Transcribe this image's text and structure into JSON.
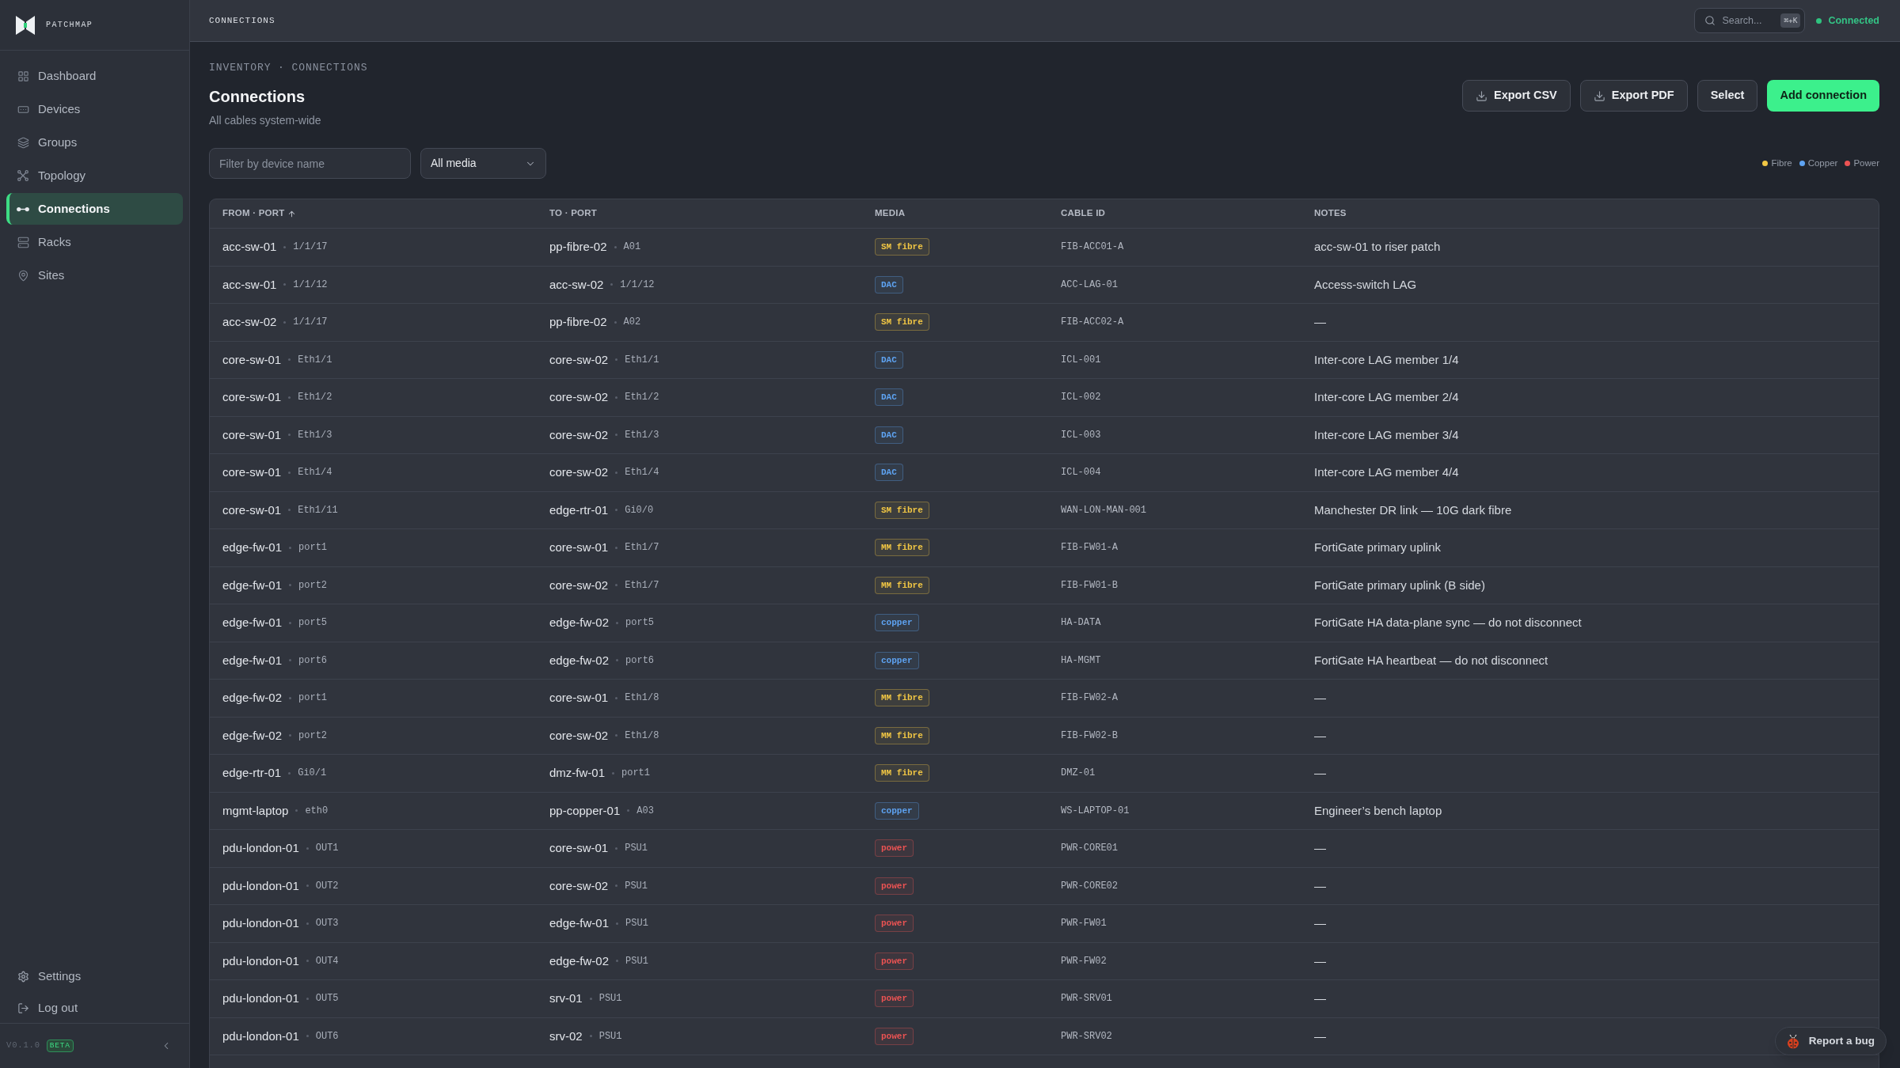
{
  "sidebar": {
    "brand": "PATCHMAP",
    "items": [
      {
        "label": "Dashboard",
        "selected": false
      },
      {
        "label": "Devices",
        "selected": false
      },
      {
        "label": "Groups",
        "selected": false
      },
      {
        "label": "Topology",
        "selected": false
      },
      {
        "label": "Connections",
        "selected": true
      },
      {
        "label": "Racks",
        "selected": false
      },
      {
        "label": "Sites",
        "selected": false
      }
    ],
    "footer_items": [
      {
        "label": "Settings"
      },
      {
        "label": "Log out"
      }
    ],
    "version": "V0.1.0",
    "badge": "BETA"
  },
  "topbar": {
    "title": "CONNECTIONS",
    "search": {
      "placeholder": "Search...",
      "shortcut": "⌘+K"
    },
    "status": "Connected"
  },
  "page": {
    "breadcrumb": "INVENTORY · CONNECTIONS",
    "title": "Connections",
    "subtitle": "All cables system-wide",
    "buttons": [
      {
        "label": "Export CSV",
        "kind": "export"
      },
      {
        "label": "Export PDF",
        "kind": "export"
      },
      {
        "label": "Select",
        "kind": "plain"
      },
      {
        "label": "Add connection",
        "kind": "primary"
      }
    ],
    "filters": {
      "device": {
        "placeholder": "Filter by device name"
      },
      "media": {
        "value": "All media"
      }
    },
    "legend": [
      {
        "label": "Fibre",
        "color": "#f2c744"
      },
      {
        "label": "Copper",
        "color": "#5ea3f2"
      },
      {
        "label": "Power",
        "color": "#ec5353"
      }
    ]
  },
  "table": {
    "columns": [
      {
        "label": "FROM · PORT",
        "sorted": true
      },
      {
        "label": "TO · PORT",
        "sorted": false
      },
      {
        "label": "MEDIA",
        "sorted": false
      },
      {
        "label": "CABLE ID",
        "sorted": false
      },
      {
        "label": "NOTES",
        "sorted": false
      }
    ],
    "rows": [
      {
        "from": {
          "device": "acc-sw-01",
          "port": "1/1/17"
        },
        "to": {
          "device": "pp-fibre-02",
          "port": "A01"
        },
        "media": {
          "label": "SM fibre",
          "color": "#f2c744"
        },
        "cable_id": "FIB-ACC01-A",
        "notes": "acc-sw-01 to riser patch"
      },
      {
        "from": {
          "device": "acc-sw-01",
          "port": "1/1/12"
        },
        "to": {
          "device": "acc-sw-02",
          "port": "1/1/12"
        },
        "media": {
          "label": "DAC",
          "color": "#5ea3f2"
        },
        "cable_id": "ACC-LAG-01",
        "notes": "Access-switch LAG"
      },
      {
        "from": {
          "device": "acc-sw-02",
          "port": "1/1/17"
        },
        "to": {
          "device": "pp-fibre-02",
          "port": "A02"
        },
        "media": {
          "label": "SM fibre",
          "color": "#f2c744"
        },
        "cable_id": "FIB-ACC02-A",
        "notes": "—"
      },
      {
        "from": {
          "device": "core-sw-01",
          "port": "Eth1/1"
        },
        "to": {
          "device": "core-sw-02",
          "port": "Eth1/1"
        },
        "media": {
          "label": "DAC",
          "color": "#5ea3f2"
        },
        "cable_id": "ICL-001",
        "notes": "Inter-core LAG member 1/4"
      },
      {
        "from": {
          "device": "core-sw-01",
          "port": "Eth1/2"
        },
        "to": {
          "device": "core-sw-02",
          "port": "Eth1/2"
        },
        "media": {
          "label": "DAC",
          "color": "#5ea3f2"
        },
        "cable_id": "ICL-002",
        "notes": "Inter-core LAG member 2/4"
      },
      {
        "from": {
          "device": "core-sw-01",
          "port": "Eth1/3"
        },
        "to": {
          "device": "core-sw-02",
          "port": "Eth1/3"
        },
        "media": {
          "label": "DAC",
          "color": "#5ea3f2"
        },
        "cable_id": "ICL-003",
        "notes": "Inter-core LAG member 3/4"
      },
      {
        "from": {
          "device": "core-sw-01",
          "port": "Eth1/4"
        },
        "to": {
          "device": "core-sw-02",
          "port": "Eth1/4"
        },
        "media": {
          "label": "DAC",
          "color": "#5ea3f2"
        },
        "cable_id": "ICL-004",
        "notes": "Inter-core LAG member 4/4"
      },
      {
        "from": {
          "device": "core-sw-01",
          "port": "Eth1/11"
        },
        "to": {
          "device": "edge-rtr-01",
          "port": "Gi0/0"
        },
        "media": {
          "label": "SM fibre",
          "color": "#f2c744"
        },
        "cable_id": "WAN-LON-MAN-001",
        "notes": "Manchester DR link — 10G dark fibre"
      },
      {
        "from": {
          "device": "edge-fw-01",
          "port": "port1"
        },
        "to": {
          "device": "core-sw-01",
          "port": "Eth1/7"
        },
        "media": {
          "label": "MM fibre",
          "color": "#f2c744"
        },
        "cable_id": "FIB-FW01-A",
        "notes": "FortiGate primary uplink"
      },
      {
        "from": {
          "device": "edge-fw-01",
          "port": "port2"
        },
        "to": {
          "device": "core-sw-02",
          "port": "Eth1/7"
        },
        "media": {
          "label": "MM fibre",
          "color": "#f2c744"
        },
        "cable_id": "FIB-FW01-B",
        "notes": "FortiGate primary uplink (B side)"
      },
      {
        "from": {
          "device": "edge-fw-01",
          "port": "port5"
        },
        "to": {
          "device": "edge-fw-02",
          "port": "port5"
        },
        "media": {
          "label": "copper",
          "color": "#5ea3f2"
        },
        "cable_id": "HA-DATA",
        "notes": "FortiGate HA data-plane sync — do not disconnect"
      },
      {
        "from": {
          "device": "edge-fw-01",
          "port": "port6"
        },
        "to": {
          "device": "edge-fw-02",
          "port": "port6"
        },
        "media": {
          "label": "copper",
          "color": "#5ea3f2"
        },
        "cable_id": "HA-MGMT",
        "notes": "FortiGate HA heartbeat — do not disconnect"
      },
      {
        "from": {
          "device": "edge-fw-02",
          "port": "port1"
        },
        "to": {
          "device": "core-sw-01",
          "port": "Eth1/8"
        },
        "media": {
          "label": "MM fibre",
          "color": "#f2c744"
        },
        "cable_id": "FIB-FW02-A",
        "notes": "—"
      },
      {
        "from": {
          "device": "edge-fw-02",
          "port": "port2"
        },
        "to": {
          "device": "core-sw-02",
          "port": "Eth1/8"
        },
        "media": {
          "label": "MM fibre",
          "color": "#f2c744"
        },
        "cable_id": "FIB-FW02-B",
        "notes": "—"
      },
      {
        "from": {
          "device": "edge-rtr-01",
          "port": "Gi0/1"
        },
        "to": {
          "device": "dmz-fw-01",
          "port": "port1"
        },
        "media": {
          "label": "MM fibre",
          "color": "#f2c744"
        },
        "cable_id": "DMZ-01",
        "notes": "—"
      },
      {
        "from": {
          "device": "mgmt-laptop",
          "port": "eth0"
        },
        "to": {
          "device": "pp-copper-01",
          "port": "A03"
        },
        "media": {
          "label": "copper",
          "color": "#5ea3f2"
        },
        "cable_id": "WS-LAPTOP-01",
        "notes": "Engineer’s bench laptop"
      },
      {
        "from": {
          "device": "pdu-london-01",
          "port": "OUT1"
        },
        "to": {
          "device": "core-sw-01",
          "port": "PSU1"
        },
        "media": {
          "label": "power",
          "color": "#ec5353"
        },
        "cable_id": "PWR-CORE01",
        "notes": "—"
      },
      {
        "from": {
          "device": "pdu-london-01",
          "port": "OUT2"
        },
        "to": {
          "device": "core-sw-02",
          "port": "PSU1"
        },
        "media": {
          "label": "power",
          "color": "#ec5353"
        },
        "cable_id": "PWR-CORE02",
        "notes": "—"
      },
      {
        "from": {
          "device": "pdu-london-01",
          "port": "OUT3"
        },
        "to": {
          "device": "edge-fw-01",
          "port": "PSU1"
        },
        "media": {
          "label": "power",
          "color": "#ec5353"
        },
        "cable_id": "PWR-FW01",
        "notes": "—"
      },
      {
        "from": {
          "device": "pdu-london-01",
          "port": "OUT4"
        },
        "to": {
          "device": "edge-fw-02",
          "port": "PSU1"
        },
        "media": {
          "label": "power",
          "color": "#ec5353"
        },
        "cable_id": "PWR-FW02",
        "notes": "—"
      },
      {
        "from": {
          "device": "pdu-london-01",
          "port": "OUT5"
        },
        "to": {
          "device": "srv-01",
          "port": "PSU1"
        },
        "media": {
          "label": "power",
          "color": "#ec5353"
        },
        "cable_id": "PWR-SRV01",
        "notes": "—"
      },
      {
        "from": {
          "device": "pdu-london-01",
          "port": "OUT6"
        },
        "to": {
          "device": "srv-02",
          "port": "PSU1"
        },
        "media": {
          "label": "power",
          "color": "#ec5353"
        },
        "cable_id": "PWR-SRV02",
        "notes": "—"
      }
    ]
  },
  "report_bug": {
    "label": "Report a bug"
  }
}
